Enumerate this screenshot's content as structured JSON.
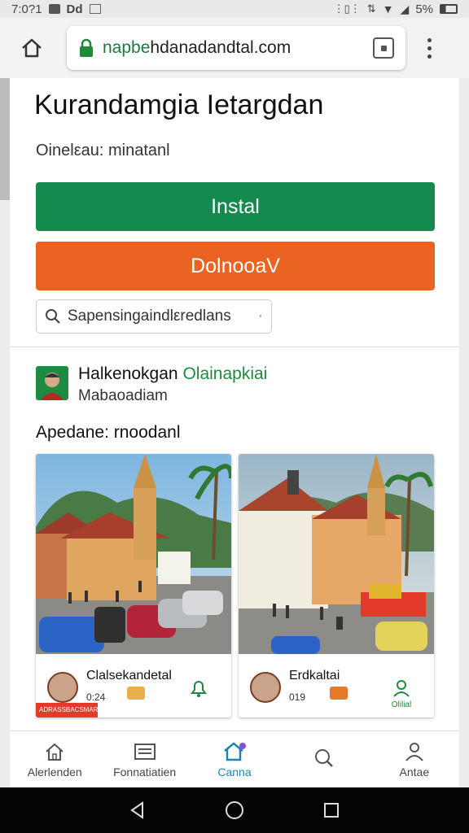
{
  "status": {
    "time": "7:0?1",
    "icons_left": "Dd",
    "battery": "5%"
  },
  "browser": {
    "url_prefix": "napbe",
    "url_domain": "hdanadandtal",
    "url_suffix": ".com"
  },
  "app": {
    "title": "Kurandamgia Ietargdan",
    "subtitle": "Oinelεau: minatanl",
    "install_label": "Instal",
    "download_label": "DolnooaV",
    "search_text": "Sapensingaindlεredlans",
    "search_end": "·"
  },
  "developer": {
    "name": "Halkenokgan",
    "name_green": "Olainapkiai",
    "meta": "Mabaoadiam"
  },
  "section": {
    "title": "Apedane: rnoodanl"
  },
  "cards": [
    {
      "title": "Clalsekandetal",
      "count": "0:24",
      "red_tag": "ADRASSBACSMAR"
    },
    {
      "title": "Erdkaltai",
      "count": "019",
      "act_label": "Olilial"
    }
  ],
  "nav": [
    {
      "label": "Alerlenden",
      "icon": "home-icon"
    },
    {
      "label": "Fonnatiatien",
      "icon": "news-icon"
    },
    {
      "label": "Canna",
      "icon": "apps-icon"
    },
    {
      "label": "",
      "icon": "search-icon"
    },
    {
      "label": "Antae",
      "icon": "account-icon"
    }
  ],
  "colors": {
    "install": "#148a4f",
    "download": "#ea6322",
    "accent": "#1a86b8"
  }
}
